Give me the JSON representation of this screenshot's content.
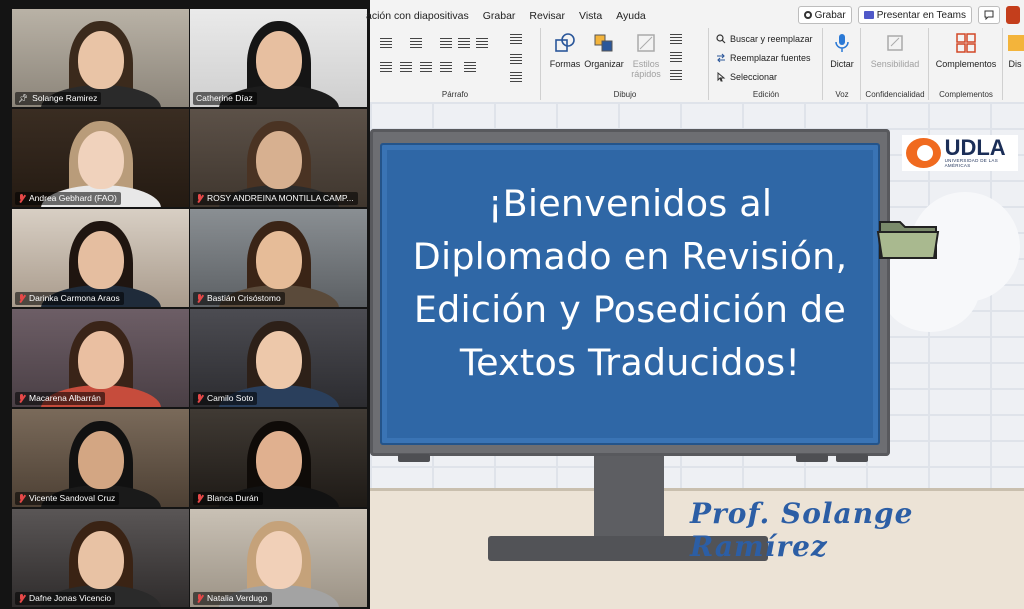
{
  "ribbon": {
    "menu": [
      "ación con diapositivas",
      "Grabar",
      "Revisar",
      "Vista",
      "Ayuda"
    ],
    "record_button": "Grabar",
    "teams_button": "Presentar en Teams",
    "groups": {
      "parrafo": "Párrafo",
      "dibujo": "Dibujo",
      "edicion": "Edición",
      "voz": "Voz",
      "confidencialidad": "Confidencialidad",
      "complementos": "Complementos"
    },
    "tools": {
      "formas": "Formas",
      "organizar": "Organizar",
      "estilos_rapidos": "Estilos rápidos",
      "buscar_reemplazar": "Buscar y reemplazar",
      "reemplazar_fuentes": "Reemplazar fuentes",
      "seleccionar": "Seleccionar",
      "dictar": "Dictar",
      "sensibilidad": "Sensibilidad",
      "complementos": "Complementos",
      "dis": "Dis"
    }
  },
  "slide": {
    "title": "¡Bienvenidos al Diplomado en Revisión, Edición y Posedición de Textos Traducidos!",
    "professor": "Prof. Solange Ramírez",
    "logo_text": "UDLA",
    "logo_subtext": "UNIVERSIDAD DE LAS AMÉRICAS"
  },
  "participants": [
    {
      "name": "Solange Ramirez",
      "muted": false,
      "pinned": true,
      "active": true
    },
    {
      "name": "Catherine Díaz",
      "muted": false,
      "pinned": false,
      "active": false
    },
    {
      "name": "Andrea Gebhard (FAO)",
      "muted": true,
      "pinned": false,
      "active": false
    },
    {
      "name": "ROSY ANDREINA MONTILLA CAMP...",
      "muted": true,
      "pinned": false,
      "active": false
    },
    {
      "name": "Darinka Carmona Araos",
      "muted": true,
      "pinned": false,
      "active": false
    },
    {
      "name": "Bastián Crisóstomo",
      "muted": true,
      "pinned": false,
      "active": false
    },
    {
      "name": "Macarena Albarrán",
      "muted": true,
      "pinned": false,
      "active": false
    },
    {
      "name": "Camilo Soto",
      "muted": true,
      "pinned": false,
      "active": false
    },
    {
      "name": "Vicente Sandoval Cruz",
      "muted": true,
      "pinned": false,
      "active": false
    },
    {
      "name": "Blanca Durán",
      "muted": true,
      "pinned": false,
      "active": false
    },
    {
      "name": "Dafne Jonas Vicencio",
      "muted": true,
      "pinned": false,
      "active": false
    },
    {
      "name": "Natalia Verdugo",
      "muted": true,
      "pinned": false,
      "active": false
    }
  ],
  "colors": {
    "active_speaker": "#3fd05a",
    "muted_mic": "#e54848",
    "slide_screen": "#2f67a6",
    "professor_text": "#2c5ea5",
    "logo_orange": "#f06a1f"
  }
}
